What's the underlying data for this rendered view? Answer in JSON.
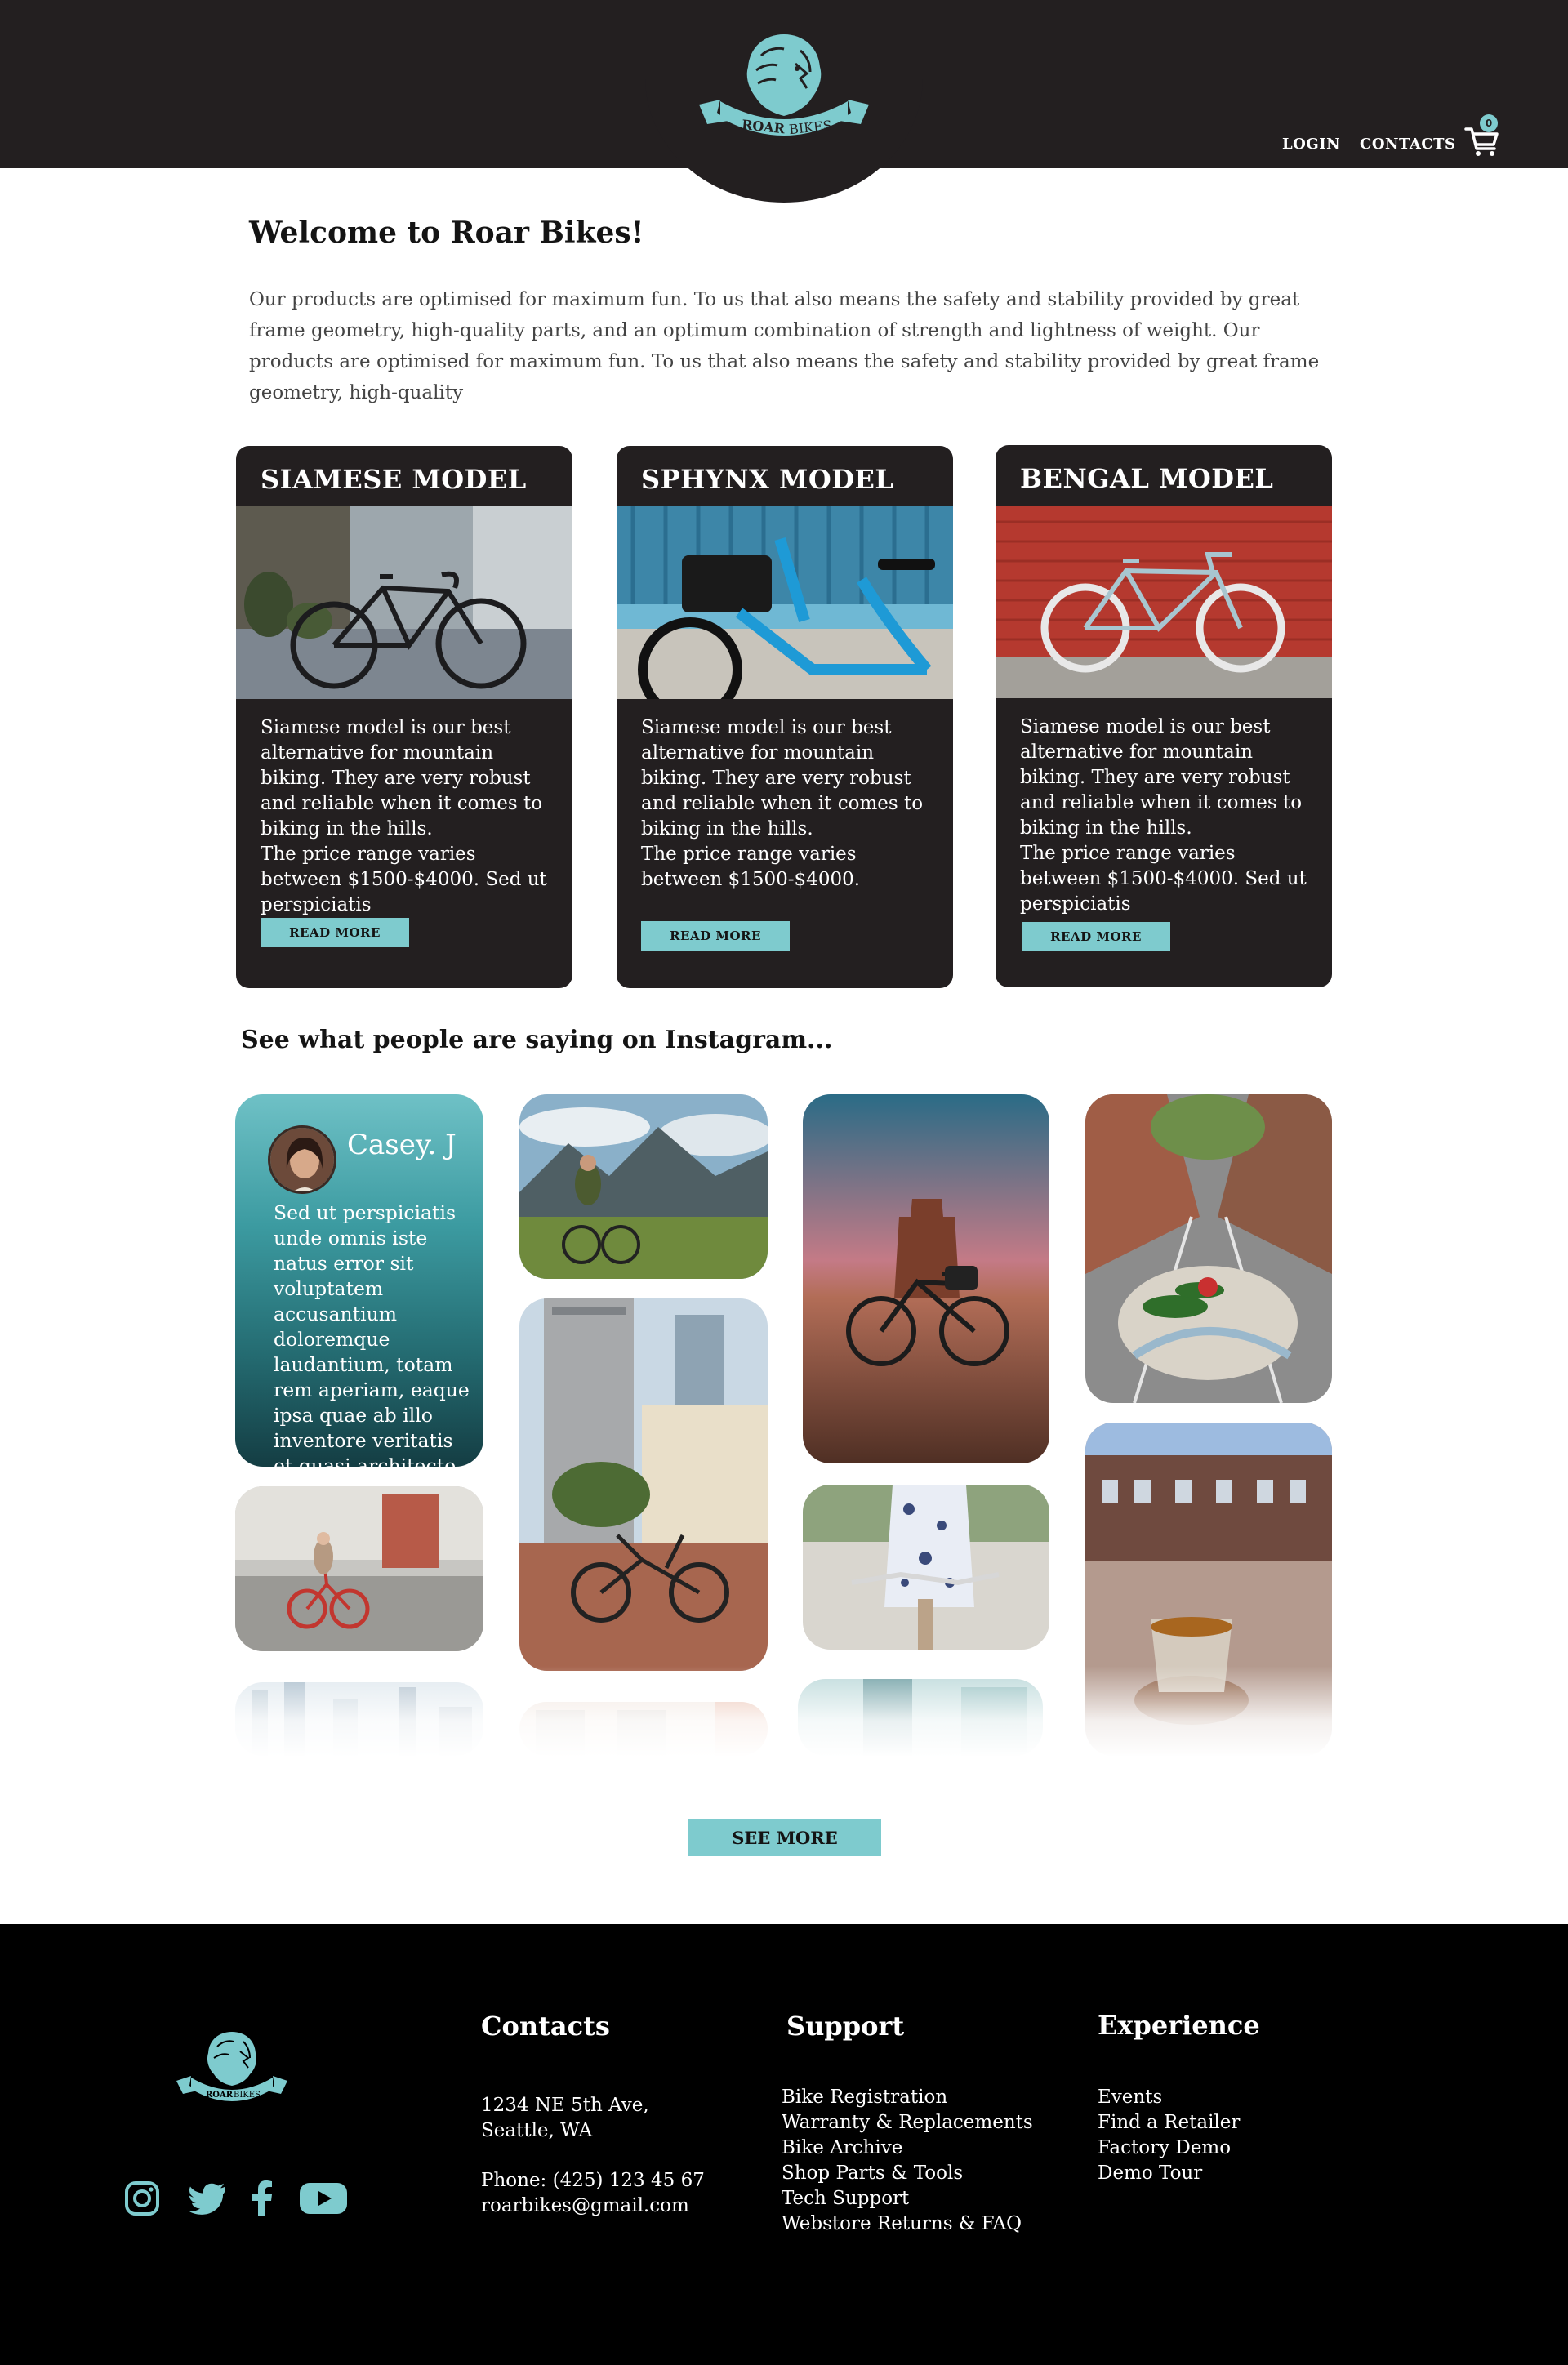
{
  "brand": {
    "logo_text_main": "ROAR",
    "logo_text_sub": "BIKES",
    "accent_color": "#7ecbce",
    "dark_color": "#231f20"
  },
  "nav": {
    "login": "LOGIN",
    "contacts": "CONTACTS",
    "cart_count": "0",
    "cart_icon": "cart-icon"
  },
  "welcome": {
    "title": "Welcome to Roar Bikes!",
    "text": "Our products are optimised for maximum fun. To us that also means the safety and stability provided by great frame geometry, high-quality parts, and an optimum combination of strength and lightness of weight. Our products are optimised for maximum fun. To us that also means the safety and stability provided by great frame geometry, high-quality"
  },
  "models": [
    {
      "title": "SIAMESE MODEL",
      "description": "Siamese model is our best alternative for mountain biking. They are very robust and reliable when it comes to biking in the hills.",
      "price": "The price range varies between $1500-$4000.  Sed ut perspiciatis",
      "button": "READ MORE"
    },
    {
      "title": "SPHYNX MODEL",
      "description": "Siamese model is our best alternative for mountain biking. They are very robust and reliable when it comes to biking in the hills.",
      "price": "The price range varies between $1500-$4000.",
      "button": "READ MORE"
    },
    {
      "title": "BENGAL MODEL",
      "description": "Siamese model is our best alternative for mountain biking. They are very robust and reliable when it comes to biking in the hills.",
      "price": "The price range varies between $1500-$4000.  Sed ut perspiciatis",
      "button": "READ MORE"
    }
  ],
  "instagram": {
    "title": "See what people are saying on Instagram...",
    "testimonial": {
      "author": "Casey. J",
      "quote": "Sed ut perspiciatis unde omnis iste natus error sit voluptatem accusantium doloremque laudantium, totam rem aperiam, eaque ipsa quae ab illo inventore veritatis et quasi architecto"
    },
    "see_more": "SEE MORE"
  },
  "footer": {
    "contacts": {
      "heading": "Contacts",
      "address_line1": "1234 NE 5th Ave,",
      "address_line2": "Seattle, WA",
      "phone": "Phone: (425) 123 45 67",
      "email": "roarbikes@gmail.com"
    },
    "support": {
      "heading": "Support",
      "items": [
        "Bike Registration",
        "Warranty & Replacements",
        "Bike Archive",
        "Shop Parts & Tools",
        "Tech Support",
        "Webstore Returns & FAQ"
      ]
    },
    "experience": {
      "heading": "Experience",
      "items": [
        "Events",
        "Find a Retailer",
        "Factory Demo",
        "Demo Tour"
      ]
    },
    "social": [
      "instagram-icon",
      "twitter-icon",
      "facebook-icon",
      "youtube-icon"
    ]
  }
}
